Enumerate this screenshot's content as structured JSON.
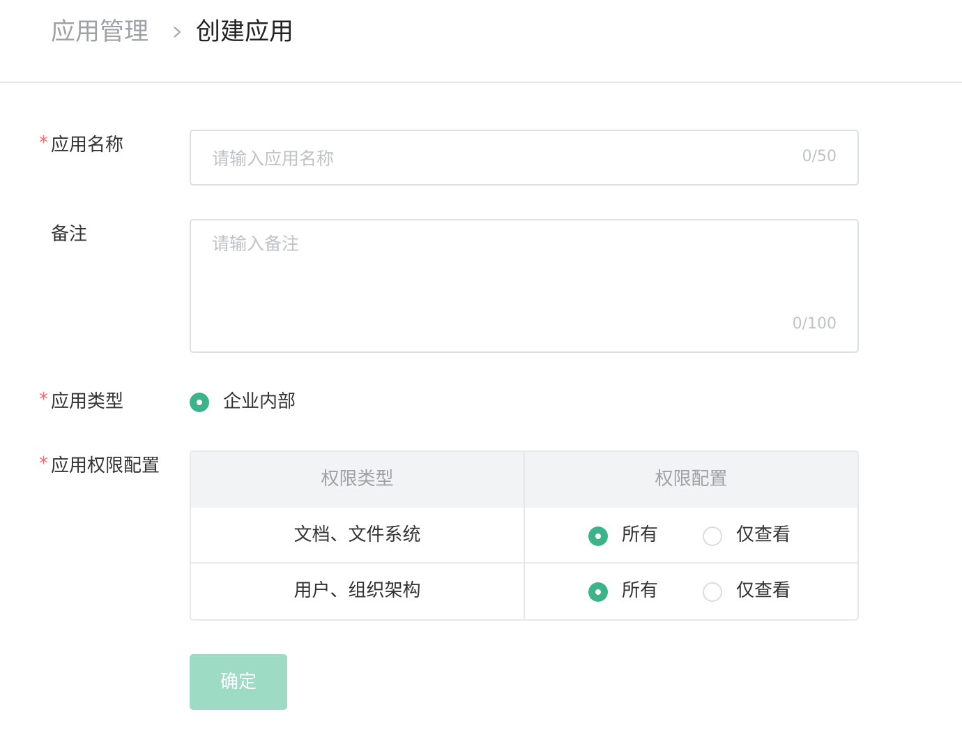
{
  "breadcrumb": {
    "parent": "应用管理",
    "current": "创建应用"
  },
  "form": {
    "app_name": {
      "label": "应用名称",
      "required_mark": "*",
      "placeholder": "请输入应用名称",
      "value": "",
      "counter": "0/50"
    },
    "remark": {
      "label": "备注",
      "placeholder": "请输入备注",
      "value": "",
      "counter": "0/100"
    },
    "app_type": {
      "label": "应用类型",
      "required_mark": "*",
      "options": [
        {
          "label": "企业内部",
          "selected": true
        }
      ]
    },
    "permissions": {
      "label": "应用权限配置",
      "required_mark": "*",
      "columns": [
        "权限类型",
        "权限配置"
      ],
      "rows": [
        {
          "type": "文档、文件系统",
          "options": [
            {
              "label": "所有",
              "selected": true
            },
            {
              "label": "仅查看",
              "selected": false
            }
          ]
        },
        {
          "type": "用户、组织架构",
          "options": [
            {
              "label": "所有",
              "selected": true
            },
            {
              "label": "仅查看",
              "selected": false
            }
          ]
        }
      ]
    }
  },
  "submit_button": {
    "label": "确定",
    "disabled": true
  },
  "colors": {
    "primary": "#3db389",
    "primary_disabled": "#9edbc5",
    "required": "#f56c6c",
    "border": "#dcdfe6",
    "placeholder": "#bfc3c9"
  }
}
